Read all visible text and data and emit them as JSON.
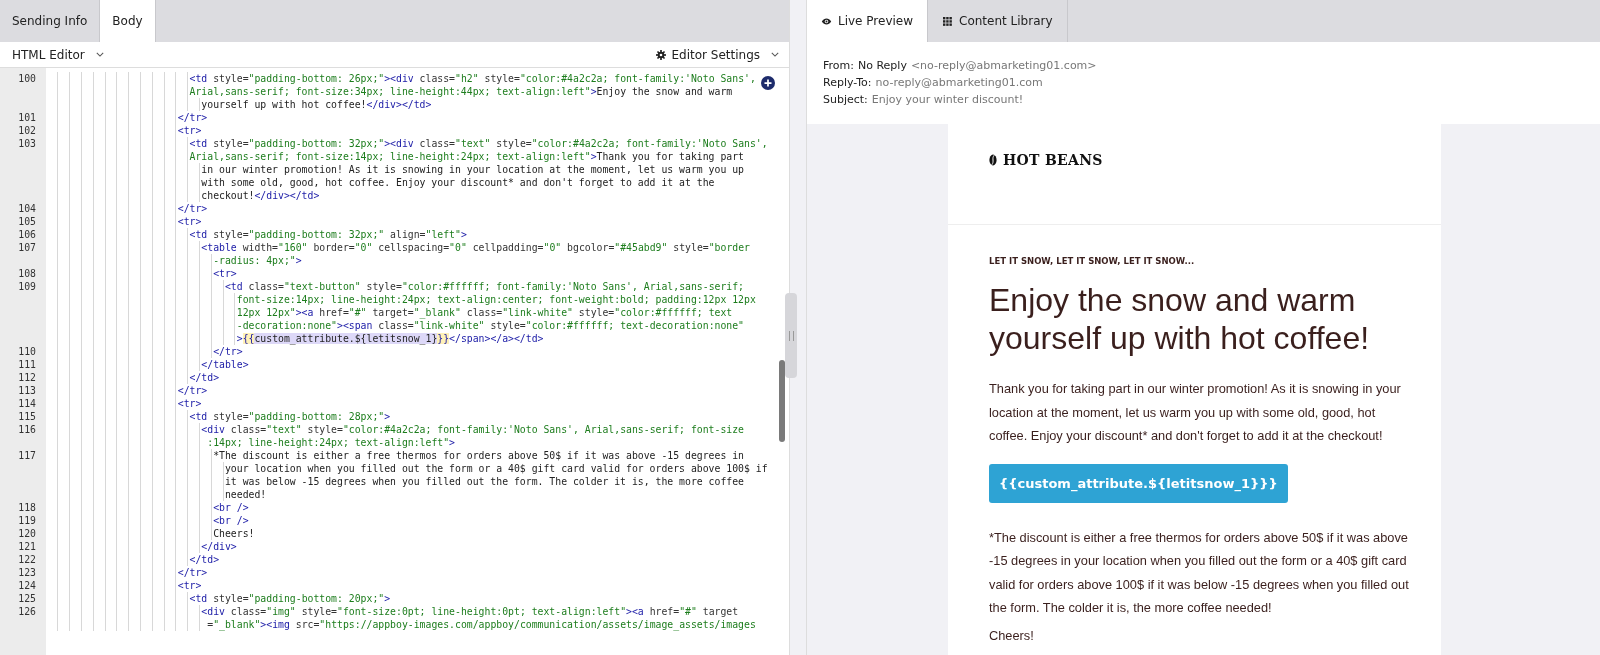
{
  "left_tabs": [
    {
      "label": "Sending Info",
      "selected": false
    },
    {
      "label": "Body",
      "selected": true
    }
  ],
  "editor": {
    "mode": "HTML Editor",
    "settings": "Editor Settings",
    "lines": [
      {
        "number": "100",
        "text": [
          "                        <td style=\"padding-bottom: 26px;\"><div class=\"h2\" style=\"color:#4a2c2a; font-family:'Noto Sans',",
          "                        Arial,sans-serif; font-size:34px; line-height:44px; text-align:left\">Enjoy the snow and warm",
          "                          yourself up with hot coffee!</div></td>"
        ]
      },
      {
        "number": "101",
        "text": [
          "                      </tr>"
        ]
      },
      {
        "number": "102",
        "text": [
          "                      <tr>"
        ]
      },
      {
        "number": "103",
        "text": [
          "                        <td style=\"padding-bottom: 32px;\"><div class=\"text\" style=\"color:#4a2c2a; font-family:'Noto Sans',",
          "                        Arial,sans-serif; font-size:14px; line-height:24px; text-align:left\">Thank you for taking part",
          "                          in our winter promotion! As it is snowing in your location at the moment, let us warm you up",
          "                          with some old, good, hot coffee. Enjoy your discount* and don't forget to add it at the",
          "                          checkout!</div></td>"
        ]
      },
      {
        "number": "104",
        "text": [
          "                      </tr>"
        ]
      },
      {
        "number": "105",
        "text": [
          "                      <tr>"
        ]
      },
      {
        "number": "106",
        "text": [
          "                        <td style=\"padding-bottom: 32px;\" align=\"left\">"
        ]
      },
      {
        "number": "107",
        "text": [
          "                          <table width=\"160\" border=\"0\" cellspacing=\"0\" cellpadding=\"0\" bgcolor=\"#45abd9\" style=\"border",
          "                            -radius: 4px;\">"
        ]
      },
      {
        "number": "108",
        "text": [
          "                            <tr>"
        ]
      },
      {
        "number": "109",
        "text": [
          "                              <td class=\"text-button\" style=\"color:#ffffff; font-family:'Noto Sans', Arial,sans-serif;",
          "                                font-size:14px; line-height:24px; text-align:center; font-weight:bold; padding:12px 12px",
          "                                12px 12px\"><a href=\"#\" target=\"_blank\" class=\"link-white\" style=\"color:#ffffff; text",
          "                                -decoration:none\"><span class=\"link-white\" style=\"color:#ffffff; text-decoration:none\"",
          "                                >{{custom_attribute.${letitsnow_1}}}</span></a></td>"
        ]
      },
      {
        "number": "110",
        "text": [
          "                            </tr>"
        ]
      },
      {
        "number": "111",
        "text": [
          "                          </table>"
        ]
      },
      {
        "number": "112",
        "text": [
          "                        </td>"
        ]
      },
      {
        "number": "113",
        "text": [
          "                      </tr>"
        ]
      },
      {
        "number": "114",
        "text": [
          "                      <tr>"
        ]
      },
      {
        "number": "115",
        "text": [
          "                        <td style=\"padding-bottom: 28px;\">"
        ]
      },
      {
        "number": "116",
        "text": [
          "                          <div class=\"text\" style=\"color:#4a2c2a; font-family:'Noto Sans', Arial,sans-serif; font-size",
          "                           :14px; line-height:24px; text-align:left\">"
        ]
      },
      {
        "number": "117",
        "text": [
          "                            *The discount is either a free thermos for orders above 50$ if it was above -15 degrees in",
          "                              your location when you filled out the form or a 40$ gift card valid for orders above 100$ if",
          "                              it was below -15 degrees when you filled out the form. The colder it is, the more coffee",
          "                              needed!"
        ]
      },
      {
        "number": "118",
        "text": [
          "                            <br />"
        ]
      },
      {
        "number": "119",
        "text": [
          "                            <br />"
        ]
      },
      {
        "number": "120",
        "text": [
          "                            Cheers!"
        ]
      },
      {
        "number": "121",
        "text": [
          "                          </div>"
        ]
      },
      {
        "number": "122",
        "text": [
          "                        </td>"
        ]
      },
      {
        "number": "123",
        "text": [
          "                      </tr>"
        ]
      },
      {
        "number": "124",
        "text": [
          "                      <tr>"
        ]
      },
      {
        "number": "125",
        "text": [
          "                        <td style=\"padding-bottom: 20px;\">"
        ]
      },
      {
        "number": "126",
        "text": [
          "                          <div class=\"img\" style=\"font-size:0pt; line-height:0pt; text-align:left\"><a href=\"#\" target",
          "                           =\"_blank\"><img src=\"https://appboy-images.com/appboy/communication/assets/image_assets/images"
        ]
      }
    ]
  },
  "right_tabs": [
    {
      "label": "Live Preview",
      "selected": true
    },
    {
      "label": "Content Library",
      "selected": false
    }
  ],
  "preview": {
    "from_label": "From:",
    "from_name": "No Reply",
    "from_address": "<no-reply@abmarketing01.com>",
    "reply_to_label": "Reply-To:",
    "reply_to": "no-reply@abmarketing01.com",
    "subject_label": "Subject:",
    "subject": "Enjoy your winter discount!",
    "brand": "HOT BEANS",
    "preheader": "LET IT SNOW, LET IT SNOW, LET IT SNOW...",
    "headline": "Enjoy the snow and warm yourself up with hot coffee!",
    "body": "Thank you for taking part in our winter promotion! As it is snowing in your location at the moment, let us warm you up with some old, good, hot coffee. Enjoy your discount* and don't forget to add it at the checkout!",
    "button": "{{custom_attribute.${letitsnow_1}}}",
    "footnote": "*The discount is either a free thermos for orders above 50$ if it was above -15 degrees in your location when you filled out the form or a 40$ gift card valid for orders above 100$ if it was below -15 degrees when you filled out the form. The colder it is, the more coffee needed!",
    "signoff": "Cheers!"
  }
}
